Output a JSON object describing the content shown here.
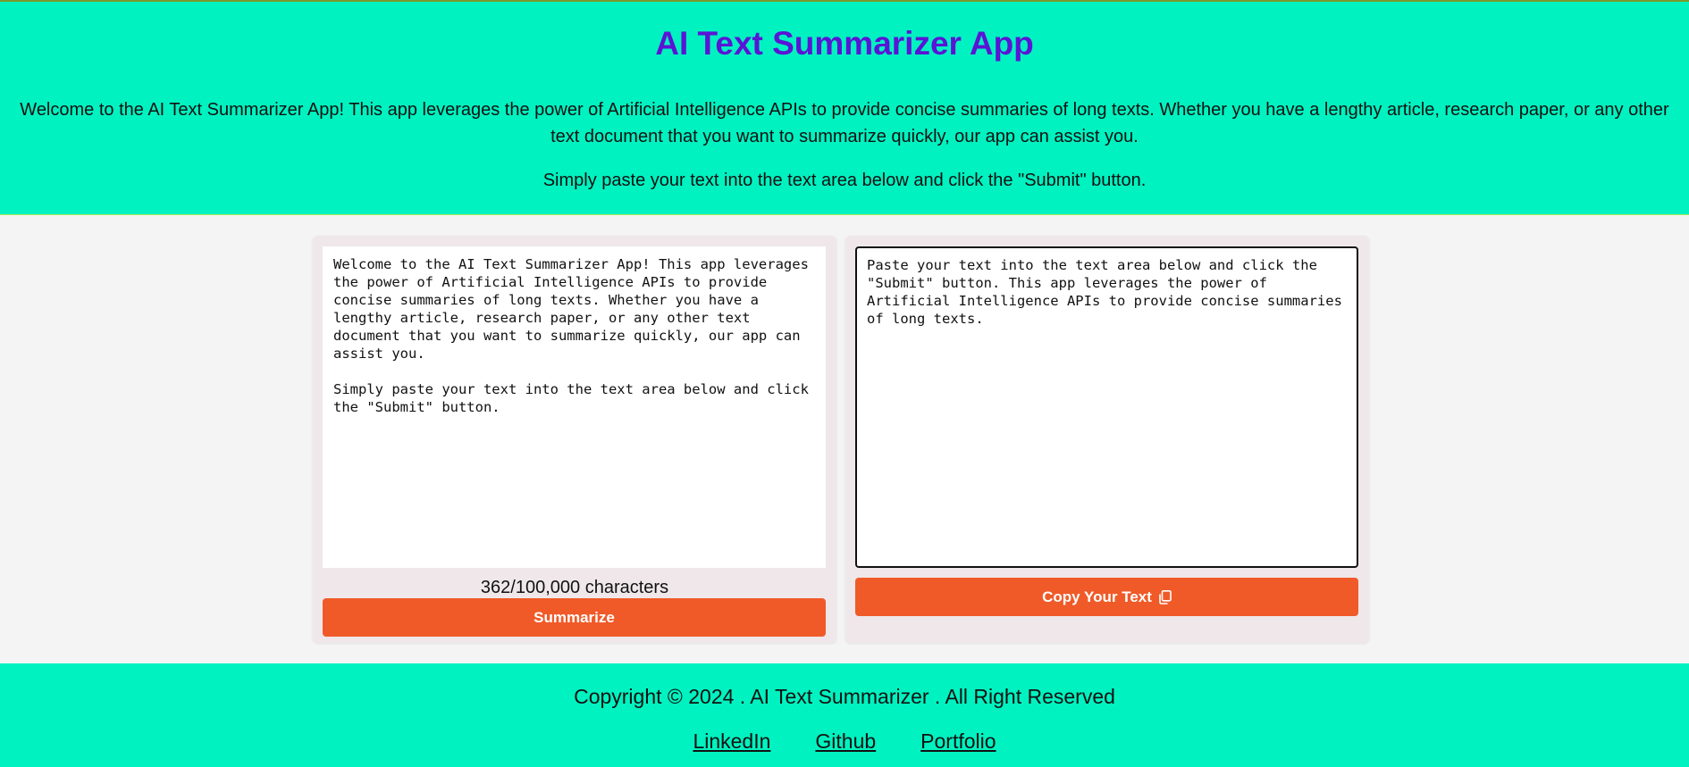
{
  "header": {
    "title": "AI Text Summarizer App",
    "intro": "Welcome to the AI Text Summarizer App! This app leverages the power of Artificial Intelligence APIs to provide concise summaries of long texts. Whether you have a lengthy article, research paper, or any other text document that you want to summarize quickly, our app can assist you.",
    "hint": "Simply paste your text into the text area below and click the \"Submit\" button."
  },
  "input_panel": {
    "text": "Welcome to the AI Text Summarizer App! This app leverages the power of Artificial Intelligence APIs to provide concise summaries of long texts. Whether you have a lengthy article, research paper, or any other text document that you want to summarize quickly, our app can assist you.\n\nSimply paste your text into the text area below and click the \"Submit\" button.",
    "char_count": "362/100,000 characters",
    "summarize_label": "Summarize"
  },
  "output_panel": {
    "text": "Paste your text into the text area below and click the \"Submit\" button. This app leverages the power of Artificial Intelligence APIs to provide concise summaries of long texts.",
    "copy_label": "Copy Your Text",
    "copy_icon": "copy-icon"
  },
  "footer": {
    "copyright": "Copyright © 2024 . AI Text Summarizer . All Right Reserved",
    "links": [
      "LinkedIn",
      "Github",
      "Portfolio"
    ]
  },
  "colors": {
    "header_bg": "#00f2c0",
    "title": "#5a14d6",
    "button": "#f05a28",
    "panel_bg": "#efe7e9",
    "page_bg": "#f4f4f4"
  }
}
